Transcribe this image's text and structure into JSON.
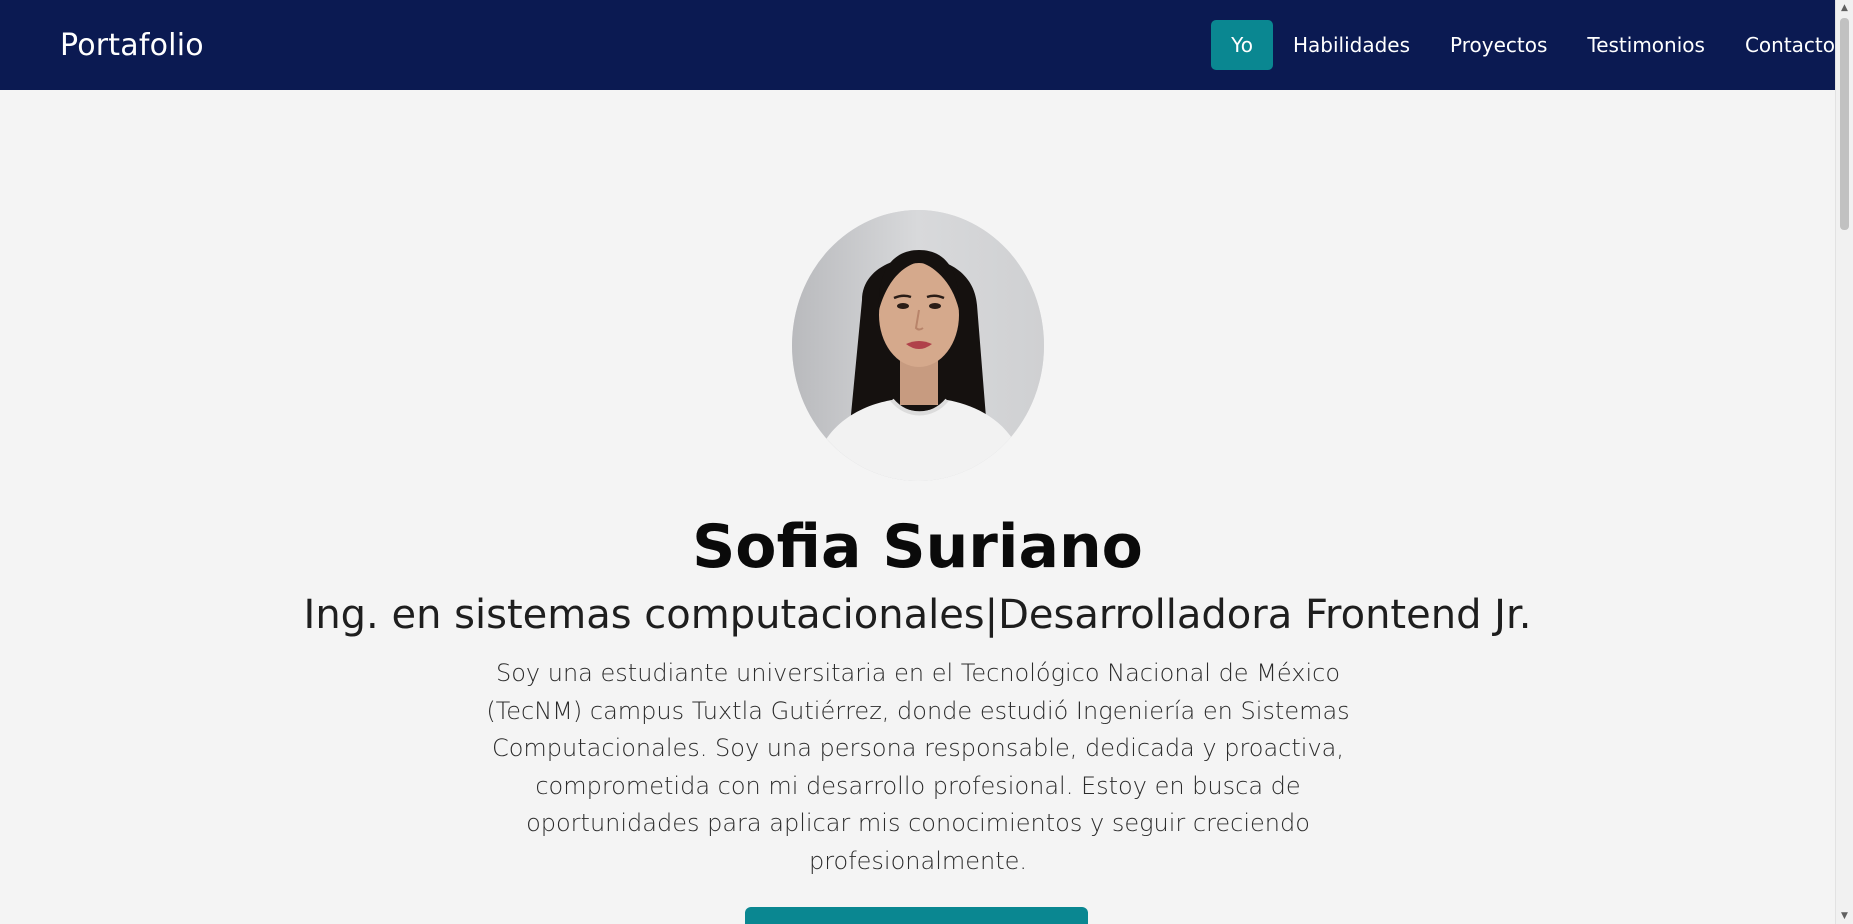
{
  "navbar": {
    "brand": "Portafolio",
    "links": [
      {
        "label": "Yo",
        "active": true
      },
      {
        "label": "Habilidades",
        "active": false
      },
      {
        "label": "Proyectos",
        "active": false
      },
      {
        "label": "Testimonios",
        "active": false
      },
      {
        "label": "Contacto",
        "active": false
      }
    ]
  },
  "hero": {
    "name": "Sofia Suriano",
    "subtitle": "Ing. en sistemas computacionales|Desarrolladora Frontend Jr.",
    "bio": "Soy una estudiante universitaria en el Tecnológico Nacional de México (TecNM) campus Tuxtla Gutiérrez, donde estudió Ingeniería en Sistemas Computacionales. Soy una persona responsable, dedicada y proactiva, comprometida con mi desarrollo profesional. Estoy en busca de oportunidades para aplicar mis conocimientos y seguir creciendo profesionalmente.",
    "cta_label": ""
  },
  "colors": {
    "nav_bg": "#0b1a52",
    "accent": "#0a8791",
    "page_bg": "#f4f4f4"
  }
}
